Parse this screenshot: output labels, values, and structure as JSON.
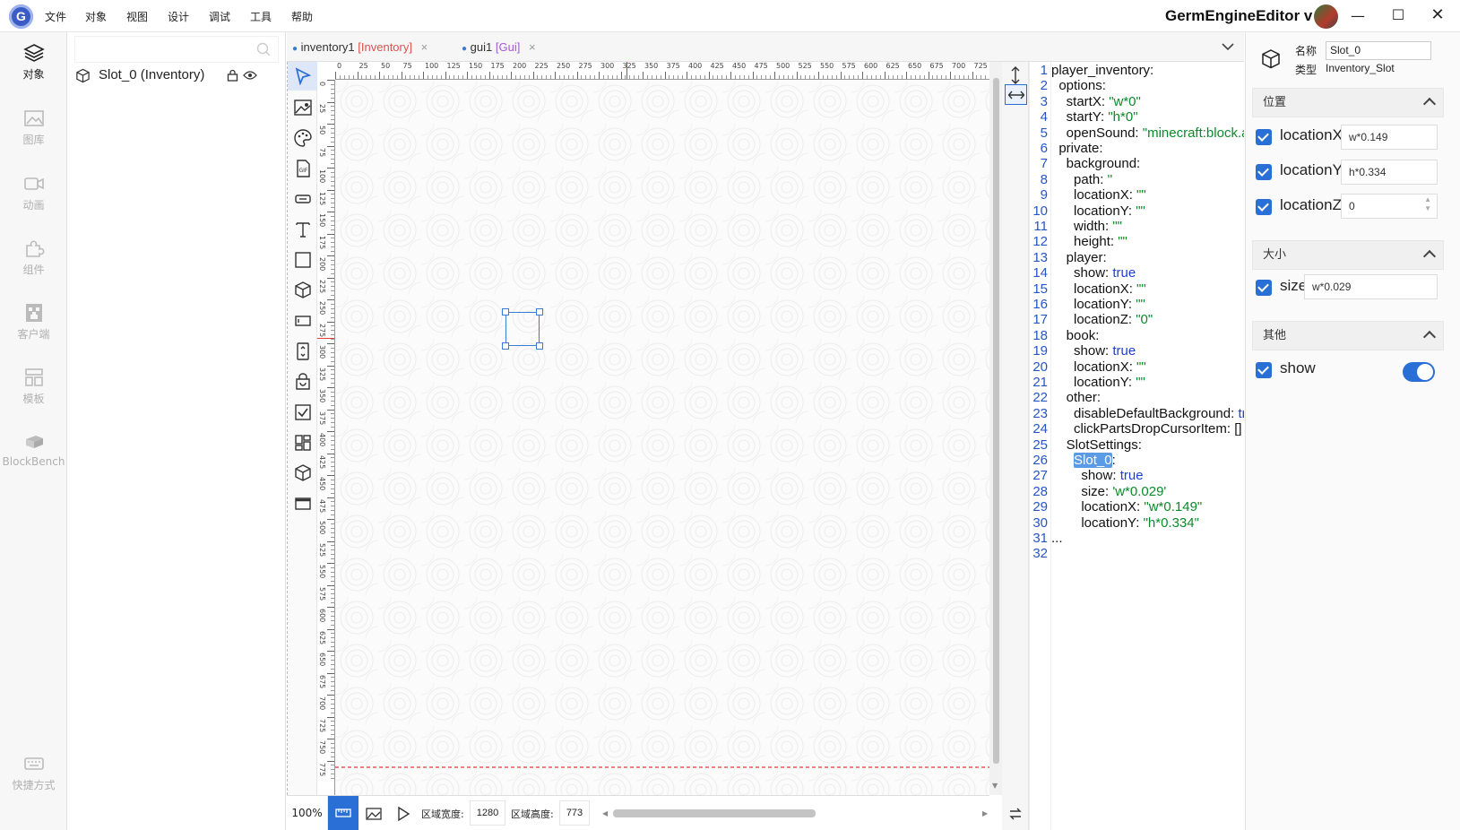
{
  "menu": [
    "文件",
    "对象",
    "视图",
    "设计",
    "调试",
    "工具",
    "帮助"
  ],
  "app_title": "GermEngineEditor v",
  "nav": [
    {
      "label": "对象",
      "icon": "layers-icon",
      "active": true
    },
    {
      "label": "图库",
      "icon": "image-icon",
      "active": false
    },
    {
      "label": "动画",
      "icon": "video-icon",
      "active": false
    },
    {
      "label": "组件",
      "icon": "puzzle-icon",
      "active": false
    },
    {
      "label": "客户端",
      "icon": "creeper-icon",
      "active": false
    },
    {
      "label": "模板",
      "icon": "template-icon",
      "active": false
    },
    {
      "label": "BlockBench",
      "icon": "blockbench-icon",
      "active": false
    },
    {
      "label": "快捷方式",
      "icon": "keyboard-icon",
      "active": false
    }
  ],
  "outline": {
    "search_placeholder": "",
    "items": [
      {
        "label": "Slot_0 (Inventory)"
      }
    ]
  },
  "tabs": [
    {
      "name": "inventory1",
      "type": "[Inventory]",
      "type_color": "#d9534f"
    },
    {
      "name": "gui1",
      "type": "[Gui]",
      "type_color": "#a45ad6"
    }
  ],
  "ruler": {
    "h": [
      "0",
      "25",
      "50",
      "75",
      "100",
      "125",
      "150",
      "175",
      "200",
      "225",
      "250",
      "275",
      "300",
      "325",
      "350",
      "375",
      "400",
      "425",
      "450",
      "475",
      "500",
      "525",
      "550",
      "575",
      "600",
      "625",
      "650",
      "675",
      "700",
      "725"
    ],
    "v": [
      "0",
      "25",
      "50",
      "75",
      "100",
      "125",
      "150",
      "175",
      "200",
      "225",
      "250",
      "275",
      "300",
      "325",
      "350",
      "375",
      "400",
      "425",
      "450",
      "475",
      "500",
      "525",
      "550",
      "575",
      "600",
      "625",
      "650",
      "675",
      "700",
      "725",
      "750",
      "775"
    ]
  },
  "status": {
    "zoom": "100%",
    "width_label": "区域宽度:",
    "width_value": "1280",
    "height_label": "区域高度:",
    "height_value": "773"
  },
  "code_lines": [
    [
      [
        "player_inventory:",
        ""
      ]
    ],
    [
      [
        "  options:",
        ""
      ]
    ],
    [
      [
        "    startX: ",
        ""
      ],
      [
        "\"w*0\"",
        "str"
      ]
    ],
    [
      [
        "    startY: ",
        ""
      ],
      [
        "\"h*0\"",
        "str"
      ]
    ],
    [
      [
        "    openSound: ",
        ""
      ],
      [
        "\"minecraft:block.a",
        "str"
      ]
    ],
    [
      [
        "  private:",
        ""
      ]
    ],
    [
      [
        "    background:",
        ""
      ]
    ],
    [
      [
        "      path: ",
        ""
      ],
      [
        "''",
        "str"
      ]
    ],
    [
      [
        "      locationX: ",
        ""
      ],
      [
        "\"\"",
        "str"
      ]
    ],
    [
      [
        "      locationY: ",
        ""
      ],
      [
        "\"\"",
        "str"
      ]
    ],
    [
      [
        "      width: ",
        ""
      ],
      [
        "\"\"",
        "str"
      ]
    ],
    [
      [
        "      height: ",
        ""
      ],
      [
        "\"\"",
        "str"
      ]
    ],
    [
      [
        "    player:",
        ""
      ]
    ],
    [
      [
        "      show: ",
        ""
      ],
      [
        "true",
        "kw"
      ]
    ],
    [
      [
        "      locationX: ",
        ""
      ],
      [
        "\"\"",
        "str"
      ]
    ],
    [
      [
        "      locationY: ",
        ""
      ],
      [
        "\"\"",
        "str"
      ]
    ],
    [
      [
        "      locationZ: ",
        ""
      ],
      [
        "\"0\"",
        "str"
      ]
    ],
    [
      [
        "    book:",
        ""
      ]
    ],
    [
      [
        "      show: ",
        ""
      ],
      [
        "true",
        "kw"
      ]
    ],
    [
      [
        "      locationX: ",
        ""
      ],
      [
        "\"\"",
        "str"
      ]
    ],
    [
      [
        "      locationY: ",
        ""
      ],
      [
        "\"\"",
        "str"
      ]
    ],
    [
      [
        "    other:",
        ""
      ]
    ],
    [
      [
        "      disableDefaultBackground: ",
        ""
      ],
      [
        "tr",
        "kw"
      ]
    ],
    [
      [
        "      clickPartsDropCursorItem: []",
        ""
      ]
    ],
    [
      [
        "    SlotSettings:",
        ""
      ]
    ],
    [
      [
        "      ",
        ""
      ],
      [
        "Slot_0",
        "hl"
      ],
      [
        ":",
        ""
      ]
    ],
    [
      [
        "        show: ",
        ""
      ],
      [
        "true",
        "kw"
      ]
    ],
    [
      [
        "        size: ",
        ""
      ],
      [
        "'w*0.029'",
        "str"
      ]
    ],
    [
      [
        "        locationX: ",
        ""
      ],
      [
        "\"w*0.149\"",
        "str"
      ]
    ],
    [
      [
        "        locationY: ",
        ""
      ],
      [
        "\"h*0.334\"",
        "str"
      ]
    ],
    [
      [
        "...",
        ""
      ]
    ],
    [
      [
        "",
        ""
      ]
    ]
  ],
  "props": {
    "name_label": "名称",
    "name_value": "Slot_0",
    "type_label": "类型",
    "type_value": "Inventory_Slot",
    "sec_position": "位置",
    "locationX_label": "locationX",
    "locationX_value": "w*0.149",
    "locationY_label": "locationY",
    "locationY_value": "h*0.334",
    "locationZ_label": "locationZ",
    "locationZ_value": "0",
    "sec_size": "大小",
    "size_label": "size",
    "size_value": "w*0.029",
    "sec_other": "其他",
    "show_label": "show",
    "show_value": true
  },
  "colors": {
    "accent": "#2a6fd6",
    "selection": "#3a7bd5",
    "dashed_line": "#e53935"
  }
}
